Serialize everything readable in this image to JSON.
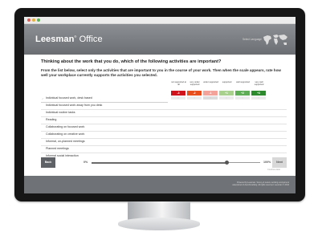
{
  "app": {
    "brand_bold": "Leesman",
    "brand_registered": "®",
    "brand_rest": "Office",
    "select_language": "Select Language"
  },
  "question": {
    "heading": "Thinking about the work that you do, which of the following activities are important?",
    "instructions": "From the list below, select only the activities that are important to you in the course of your work. Then when the scale appears, rate how well your workplace currently supports the activities you selected."
  },
  "scale": [
    {
      "label": "not supported at all",
      "value": "-3",
      "color": "#d0121b"
    },
    {
      "label": "very under supported",
      "value": "-2",
      "color": "#e84e1b"
    },
    {
      "label": "under supported",
      "value": "-1",
      "color": "#f4a39a"
    },
    {
      "label": "supported",
      "value": "+1",
      "color": "#a9d18e"
    },
    {
      "label": "well supported",
      "value": "+2",
      "color": "#5fad56"
    },
    {
      "label": "very well supported",
      "value": "+3",
      "color": "#2d8a2d"
    }
  ],
  "activities": [
    {
      "label": "Individual focused work, desk based",
      "selected": true
    },
    {
      "label": "Individual focused work away from you desk",
      "selected": false
    },
    {
      "label": "Individual routine tasks",
      "selected": false
    },
    {
      "label": "Reading",
      "selected": false
    },
    {
      "label": "Collaborating on focused work",
      "selected": false
    },
    {
      "label": "Collaborating on creative work",
      "selected": false
    },
    {
      "label": "Informal, un-planned meetings",
      "selected": false
    },
    {
      "label": "Planned meetings",
      "selected": false
    },
    {
      "label": "Informal social interaction",
      "selected": false
    }
  ],
  "navigation": {
    "back_label": "Back",
    "next_label": "Next",
    "progress_start": "0%",
    "progress_end": "100%",
    "progress": 0.8,
    "continue_note": "Continue later"
  },
  "footer": {
    "line1": "Powered by Leesman. Survey & review, working environment",
    "line2": "assessment & benchmarking. All rights reserved. Leesman © 2014"
  },
  "colors": {
    "banner": "#7b7e82",
    "footer": "#6f7276",
    "bezel": "#161616",
    "window_dot_red": "#e05c55",
    "window_dot_yellow": "#e8b33a",
    "window_dot_green": "#57b94a"
  },
  "icons": [
    "world-map-icon",
    "window-close-dot",
    "window-minimize-dot",
    "window-maximize-dot"
  ]
}
